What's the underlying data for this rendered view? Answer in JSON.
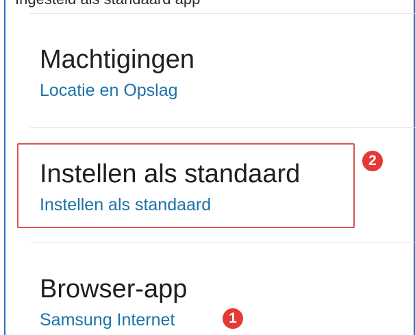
{
  "top_text_partial": "Ingesteld als standaard app",
  "settings": [
    {
      "title": "Machtigingen",
      "subtitle": "Locatie en Opslag"
    },
    {
      "title": "Instellen als standaard",
      "subtitle": "Instellen als standaard"
    },
    {
      "title": "Browser-app",
      "subtitle": "Samsung Internet"
    }
  ],
  "annotations": {
    "badge_1": "1",
    "badge_2": "2",
    "highlight_color": "#d9534f",
    "badge_color": "#e53935"
  },
  "colors": {
    "title_text": "#1f1f1f",
    "subtitle_text": "#1a73a8",
    "frame_border": "#2f6fc1"
  }
}
